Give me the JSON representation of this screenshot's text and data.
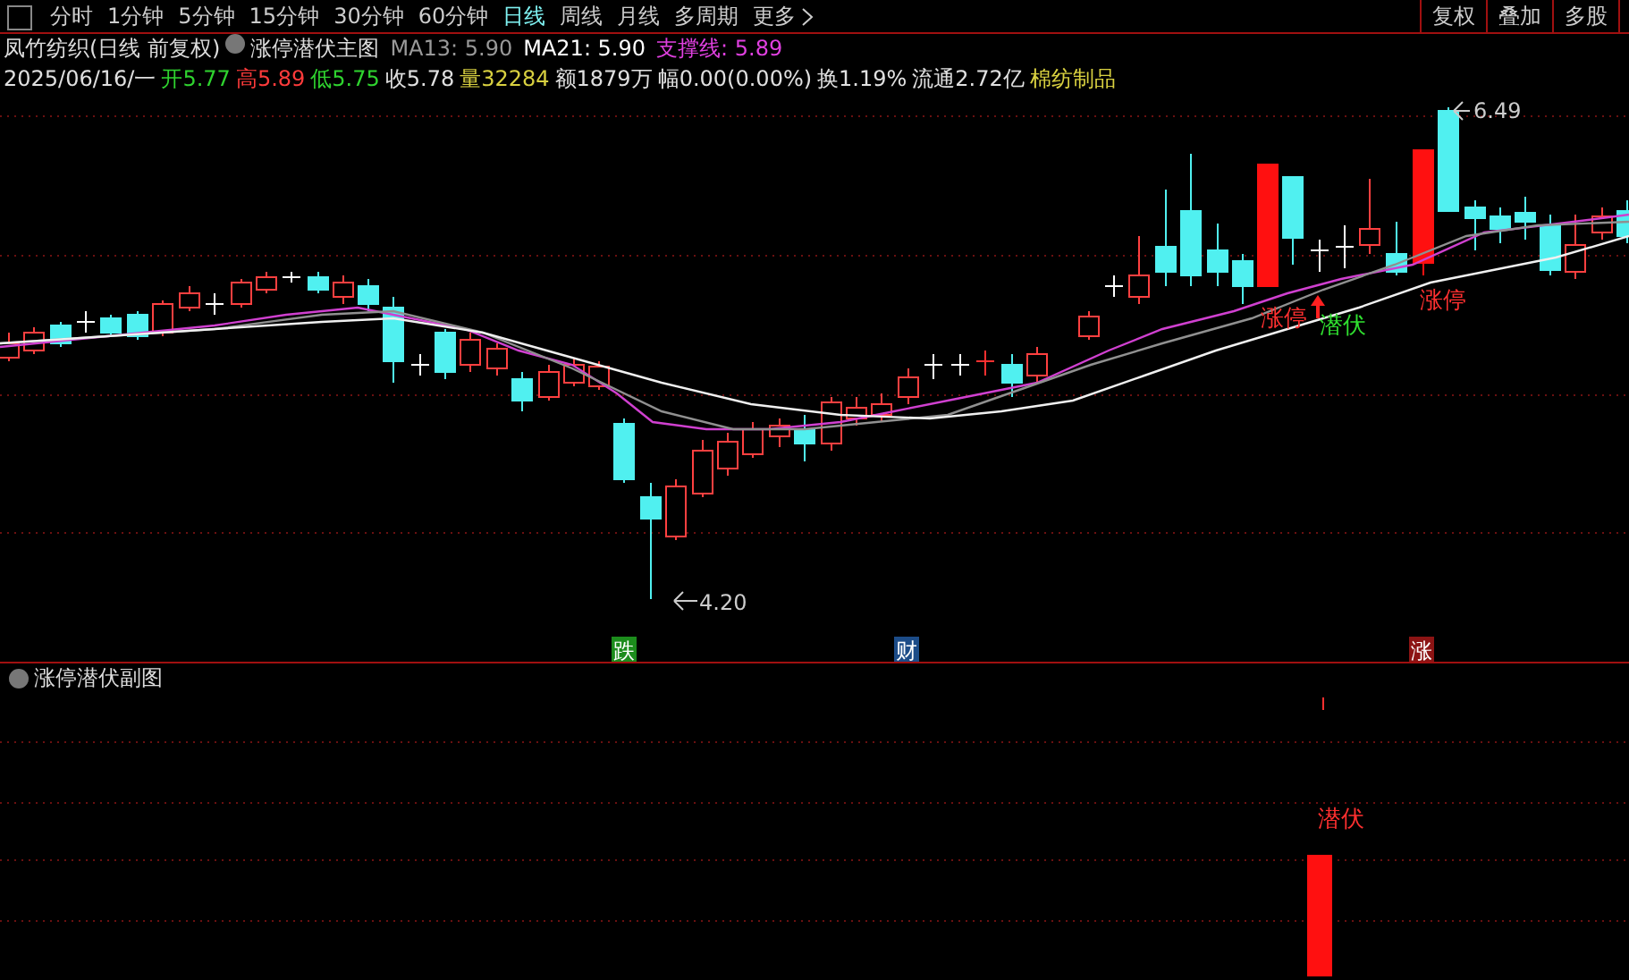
{
  "toolbar": {
    "periods": [
      {
        "label": "分时",
        "selected": false
      },
      {
        "label": "1分钟",
        "selected": false
      },
      {
        "label": "5分钟",
        "selected": false
      },
      {
        "label": "15分钟",
        "selected": false
      },
      {
        "label": "30分钟",
        "selected": false
      },
      {
        "label": "60分钟",
        "selected": false
      },
      {
        "label": "日线",
        "selected": true
      },
      {
        "label": "周线",
        "selected": false
      },
      {
        "label": "月线",
        "selected": false
      },
      {
        "label": "多周期",
        "selected": false
      }
    ],
    "more": "更多",
    "right_buttons": [
      "复权",
      "叠加",
      "多股"
    ]
  },
  "header": {
    "title": "凤竹纺织(日线 前复权)",
    "indicator": "涨停潜伏主图",
    "ma13": "MA13: 5.90",
    "ma21": "MA21: 5.90",
    "support": "支撑线: 5.89"
  },
  "quote": [
    {
      "text": "2025/06/16/一",
      "color": "#e0e0e0"
    },
    {
      "text": "开5.77",
      "color": "#2fd32f"
    },
    {
      "text": "高5.89",
      "color": "#ff3b3b"
    },
    {
      "text": "低5.75",
      "color": "#2fd32f"
    },
    {
      "text": "收5.78",
      "color": "#e0e0e0"
    },
    {
      "text": "量32284",
      "color": "#d8d040"
    },
    {
      "text": "额1879万",
      "color": "#e0e0e0"
    },
    {
      "text": "幅0.00(0.00%)",
      "color": "#e0e0e0"
    },
    {
      "text": "换1.19%",
      "color": "#e0e0e0"
    },
    {
      "text": "流通2.72亿",
      "color": "#e0e0e0"
    },
    {
      "text": "棉纺制品",
      "color": "#d8d040"
    }
  ],
  "main_chart": {
    "high_label": "6.49",
    "low_label": "4.20",
    "signals": [
      {
        "text": "涨停",
        "kind": "limit"
      },
      {
        "text": "潜伏",
        "kind": "lurk"
      },
      {
        "text": "涨停",
        "kind": "limit"
      }
    ],
    "date_tags": [
      {
        "text": "跌",
        "color": "#1c8c1c"
      },
      {
        "text": "财",
        "color": "#1c4c88"
      },
      {
        "text": "涨",
        "color": "#8c1414"
      }
    ]
  },
  "sub_chart": {
    "title": "涨停潜伏副图",
    "signal": "潜伏"
  }
}
